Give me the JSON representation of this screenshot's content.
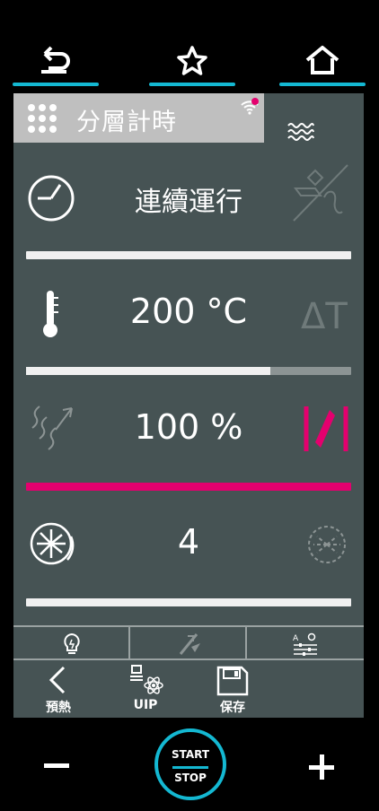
{
  "accent": "#14b8d2",
  "pink": "#e4006e",
  "nav": {
    "back_icon": "back-arrow-icon",
    "favorite_icon": "star-icon",
    "home_icon": "home-icon"
  },
  "panel": {
    "title": "分層計時",
    "rows": {
      "time": {
        "value": "連續運行",
        "bar_fraction": 1.0
      },
      "temperature": {
        "value": "200 °C",
        "bar_fraction": 0.75,
        "delta_label": "ΔT"
      },
      "humidity": {
        "value": "100 %",
        "bar_fraction": 1.0
      },
      "fan": {
        "value": "4",
        "bar_fraction": 1.0
      }
    }
  },
  "bottom": {
    "preheat_label": "預熱",
    "uip_label": "UIP",
    "save_label": "保存"
  },
  "footer": {
    "start_label": "START",
    "stop_label": "STOP"
  }
}
